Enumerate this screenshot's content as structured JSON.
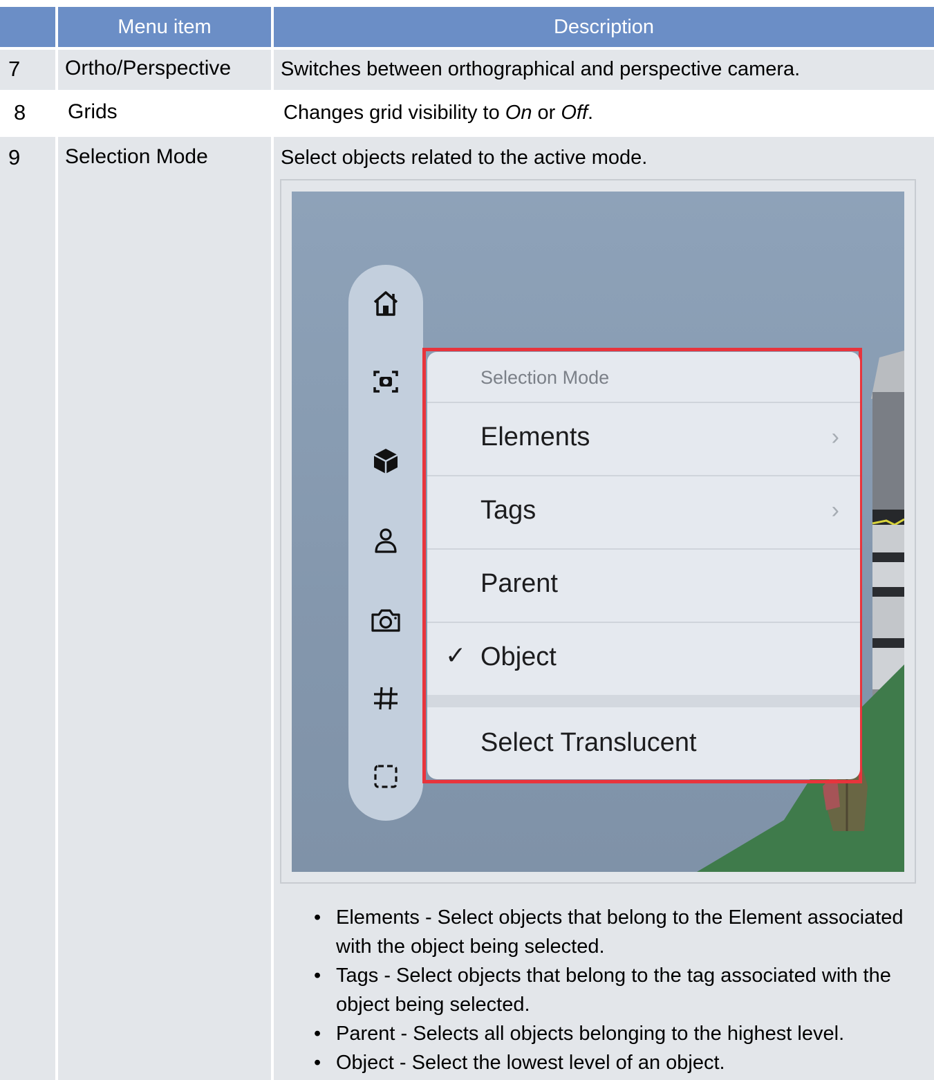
{
  "table": {
    "headers": [
      "",
      "Menu item",
      "Description"
    ],
    "rows": [
      {
        "num": "7",
        "item": "Ortho/Perspective",
        "desc": "Switches between orthographical and perspective camera."
      },
      {
        "num": "8",
        "item": "Grids",
        "desc_prefix": "Changes grid visibility to ",
        "desc_on": "On",
        "desc_mid": " or ",
        "desc_off": "Off",
        "desc_suffix": "."
      },
      {
        "num": "9",
        "item": "Selection Mode",
        "desc": "Select objects related to the active mode."
      }
    ]
  },
  "screenshot": {
    "toolbar_icons": [
      "home-icon",
      "capture-icon",
      "cube-icon",
      "person-icon",
      "camera-icon",
      "grid-hash-icon",
      "selection-box-icon"
    ],
    "menu": {
      "title": "Selection Mode",
      "items": [
        {
          "label": "Elements",
          "submenu": true,
          "checked": false
        },
        {
          "label": "Tags",
          "submenu": true,
          "checked": false
        },
        {
          "label": "Parent",
          "submenu": false,
          "checked": false
        },
        {
          "label": "Object",
          "submenu": false,
          "checked": true
        },
        {
          "label": "Select Translucent",
          "submenu": false,
          "checked": false
        }
      ],
      "chevron": "›",
      "checkmark": "✓"
    },
    "highlight_color": "#e8343c"
  },
  "bullets": [
    {
      "term": "Elements",
      "text": " - Select objects that belong to the Element associated with the object being selected."
    },
    {
      "term": "Tags",
      "text": " - Select objects that belong to the tag associated with the object being selected."
    },
    {
      "term": "Parent",
      "text": " - Selects all objects belonging to the highest level."
    },
    {
      "term": "Object",
      "text": " - Select the lowest level of an object."
    }
  ],
  "colors": {
    "header": "#6b8ec6",
    "cell": "#e3e6ea",
    "accent_red": "#e8343c"
  }
}
